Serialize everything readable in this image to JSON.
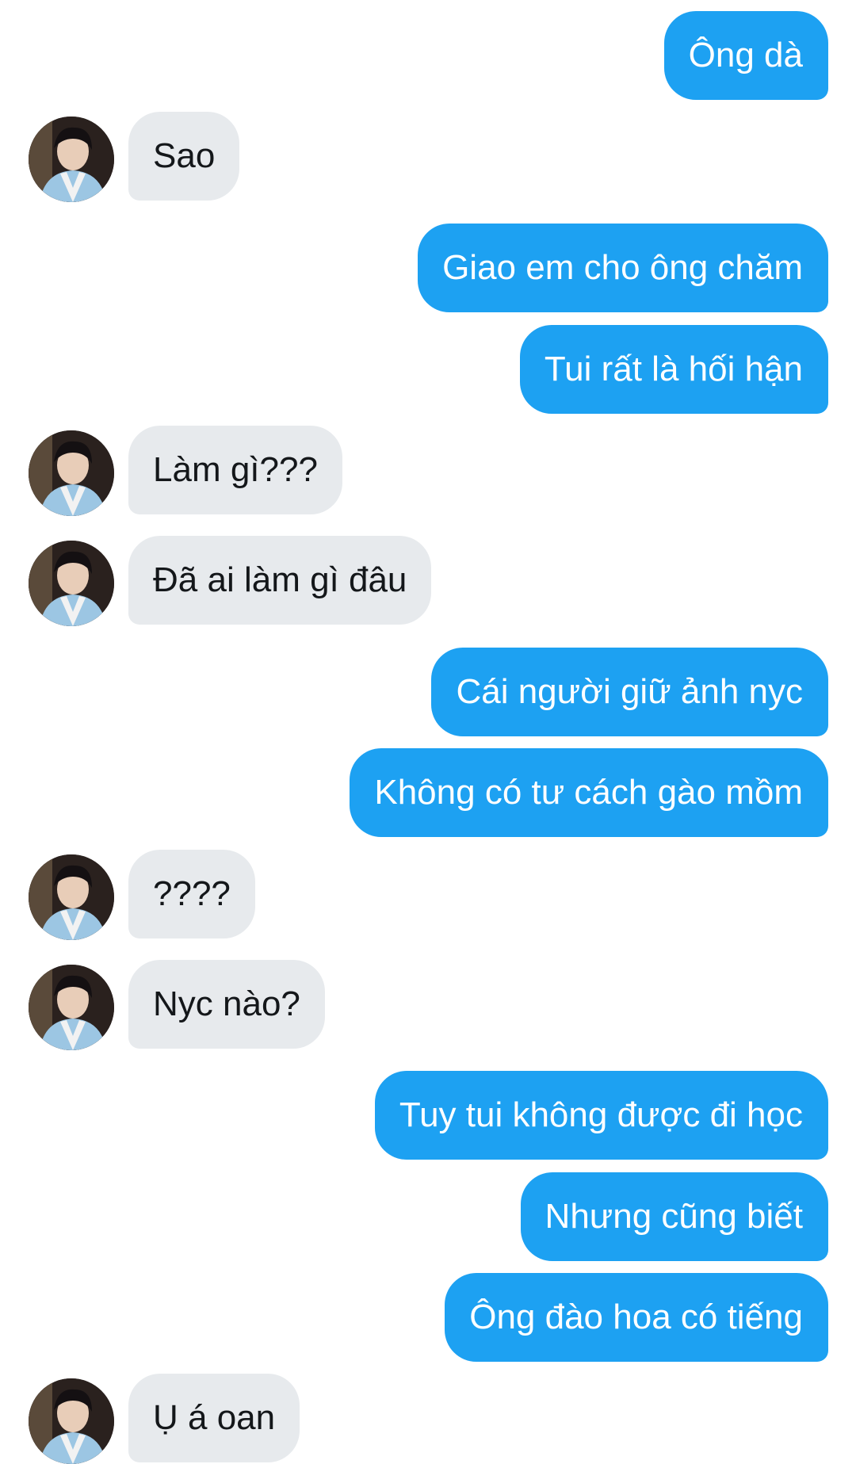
{
  "messages": [
    {
      "side": "out",
      "text": "Ông dà"
    },
    {
      "side": "in",
      "text": "Sao"
    },
    {
      "side": "out",
      "text": "Giao em cho ông chăm"
    },
    {
      "side": "out",
      "text": "Tui rất là hối hận"
    },
    {
      "side": "in",
      "text": "Làm gì???"
    },
    {
      "side": "in",
      "text": "Đã ai làm gì đâu"
    },
    {
      "side": "out",
      "text": "Cái người giữ ảnh nyc"
    },
    {
      "side": "out",
      "text": "Không có tư cách gào mồm"
    },
    {
      "side": "in",
      "text": "????"
    },
    {
      "side": "in",
      "text": "Nyc nào?"
    },
    {
      "side": "out",
      "text": "Tuy tui không được đi học"
    },
    {
      "side": "out",
      "text": "Nhưng cũng biết"
    },
    {
      "side": "out",
      "text": "Ông đào hoa có tiếng"
    },
    {
      "side": "in",
      "text": "Ụ á oan"
    }
  ],
  "colors": {
    "outgoing_bubble": "#1da1f2",
    "incoming_bubble": "#e7eaed",
    "incoming_text": "#14171a",
    "background": "#ffffff"
  },
  "icons": {
    "avatar": "contact-avatar-photo"
  }
}
